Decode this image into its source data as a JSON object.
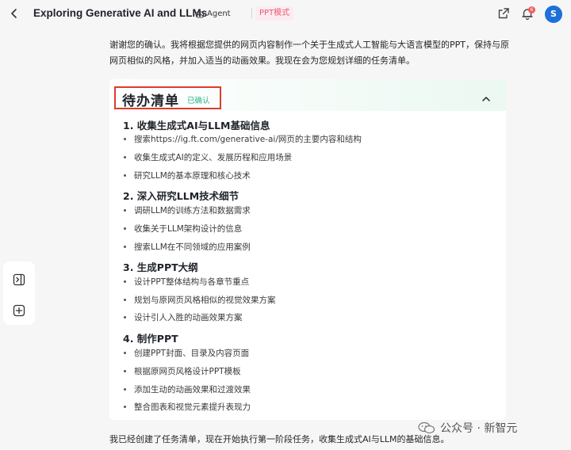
{
  "header": {
    "title": "Exploring Generative AI and LLMs",
    "agent_label": "Agent",
    "mode_label": "PPT模式",
    "notification_count": "6",
    "avatar_initial": "S"
  },
  "intro_text": "谢谢您的确认。我将根据您提供的网页内容制作一个关于生成式人工智能与大语言模型的PPT，保持与原网页相似的风格，并加入适当的动画效果。我现在会为您规划详细的任务清单。",
  "todo": {
    "title": "待办清单",
    "status": "已确认",
    "sections": [
      {
        "title": "1. 收集生成式AI与LLM基础信息",
        "tasks": [
          "搜索https://ig.ft.com/generative-ai/网页的主要内容和结构",
          "收集生成式AI的定义、发展历程和应用场景",
          "研究LLM的基本原理和核心技术"
        ]
      },
      {
        "title": "2. 深入研究LLM技术细节",
        "tasks": [
          "调研LLM的训练方法和数据需求",
          "收集关于LLM架构设计的信息",
          "搜索LLM在不同领域的应用案例"
        ]
      },
      {
        "title": "3. 生成PPT大纲",
        "tasks": [
          "设计PPT整体结构与各章节重点",
          "规划与原网页风格相似的视觉效果方案",
          "设计引人入胜的动画效果方案"
        ]
      },
      {
        "title": "4. 制作PPT",
        "tasks": [
          "创建PPT封面、目录及内容页面",
          "根据原网页风格设计PPT模板",
          "添加生动的动画效果和过渡效果",
          "整合图表和视觉元素提升表现力"
        ]
      }
    ]
  },
  "outro_text": "我已经创建了任务清单，现在开始执行第一阶段任务，收集生成式AI与LLM的基础信息。",
  "watermark": "公众号 · 新智元",
  "colors": {
    "accent_red": "#e03a2f",
    "confirmed_green": "#2fb38a",
    "mode_pink": "#e65a78",
    "avatar_blue": "#1e6fd9"
  }
}
